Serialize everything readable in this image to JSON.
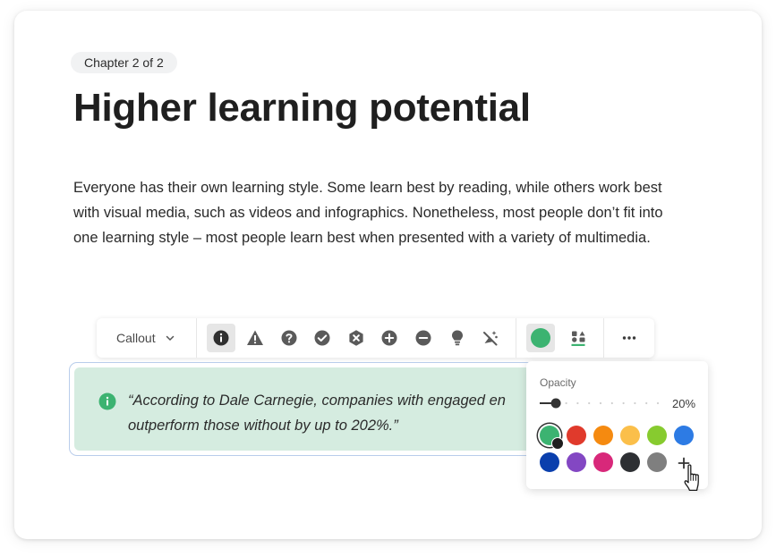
{
  "page": {
    "chapter": "Chapter 2 of 2",
    "title": "Higher learning potential",
    "paragraph": "Everyone has their own learning style. Some learn best by reading, while others work best with visual media, such as videos and infographics. Nonetheless, most people don’t fit into one learning style – most people learn best when presented with a variety of multimedia."
  },
  "toolbar": {
    "type_label": "Callout",
    "icons": [
      "info-icon",
      "warning-icon",
      "question-icon",
      "check-icon",
      "error-icon",
      "plus-circle-icon",
      "minus-circle-icon",
      "lightbulb-icon",
      "no-icon-icon"
    ],
    "active_icon": "info-icon",
    "color_button": "#3cb371",
    "style_button": "style-icon",
    "more_button": "more-icon"
  },
  "callout": {
    "line1": "“According to Dale Carnegie, companies with engaged en",
    "line2": "outperform those without by up to 202%.”",
    "icon": "info-icon",
    "icon_color": "#3cb371",
    "background": "#d5ece0"
  },
  "color_popover": {
    "opacity_label": "Opacity",
    "opacity_value": "20%",
    "opacity_fraction": 0.2,
    "colors_row1": [
      "#3cb371",
      "#e03a2c",
      "#f58a10",
      "#fbbf4a",
      "#87cb2f",
      "#2d7be4"
    ],
    "colors_row2": [
      "#0a3fad",
      "#8347c3",
      "#d8287a",
      "#2d2f33",
      "#7f7f7f"
    ],
    "selected_color": "#3cb371",
    "add_icon": "plus-icon"
  }
}
